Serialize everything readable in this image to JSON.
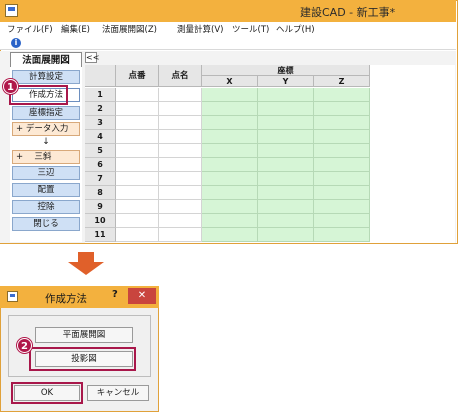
{
  "main_window": {
    "title": "建設CAD - 新工事*",
    "menu": [
      "ファイル(F)",
      "編集(E)",
      "法面展開図(Z)",
      "測量計算(V)",
      "ツール(T)",
      "ヘルプ(H)"
    ],
    "panel": {
      "tab": "法面展開図",
      "buttons": [
        "計算設定",
        "作成方法",
        "座標指定",
        "+ データ入力",
        "↓",
        "+ 　三斜",
        "三辺",
        "配置",
        "控除",
        "閉じる"
      ]
    },
    "collapse_label": "<<",
    "grid": {
      "headers": {
        "point_no": "点番",
        "point_name": "点名",
        "coord_group": "座標",
        "x": "X",
        "y": "Y",
        "z": "Z"
      },
      "row_numbers": [
        "1",
        "2",
        "3",
        "4",
        "5",
        "6",
        "7",
        "8",
        "9",
        "10",
        "11"
      ]
    }
  },
  "dialog": {
    "title": "作成方法",
    "help": "?",
    "close": "✕",
    "buttons": {
      "plan": "平面展開図",
      "projection": "投影図",
      "ok": "OK",
      "cancel": "キャンセル"
    }
  },
  "callouts": {
    "first": "1",
    "second": "2"
  },
  "icons": {
    "info": "i"
  },
  "colors": {
    "titlebar": "#f3b13e",
    "panel_button": "#cfe0f5",
    "grid_green": "#d6f5d6",
    "callout": "#b0174a",
    "arrow": "#e0602a"
  }
}
